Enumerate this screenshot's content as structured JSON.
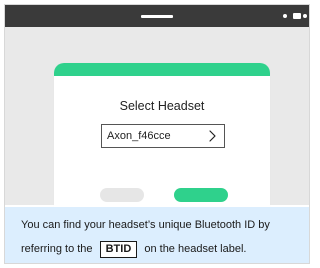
{
  "dialog": {
    "title": "Select Headset",
    "select_value": "Axon_f46cce"
  },
  "icons": {
    "select_chevron": "chevron-right-icon"
  },
  "info": {
    "line1": "You can find your headset’s unique Bluetooth ID by",
    "line2_before": "referring to the",
    "badge": "BTID",
    "line2_after": "on the headset label."
  },
  "colors": {
    "accent": "#2fd18c",
    "status_bar": "#3a3a3a",
    "info_background": "#dceefe",
    "screen_background": "#e9e9e9"
  }
}
